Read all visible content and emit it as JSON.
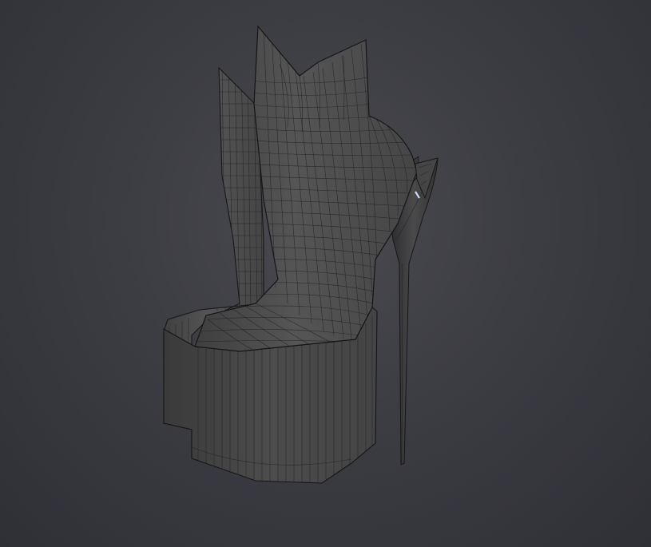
{
  "viewport": {
    "background_color": "#3c3c43",
    "model_color": "#4a4a4b",
    "wire_color": "#1d1d20",
    "highlight_color": "#cfd8ff"
  }
}
